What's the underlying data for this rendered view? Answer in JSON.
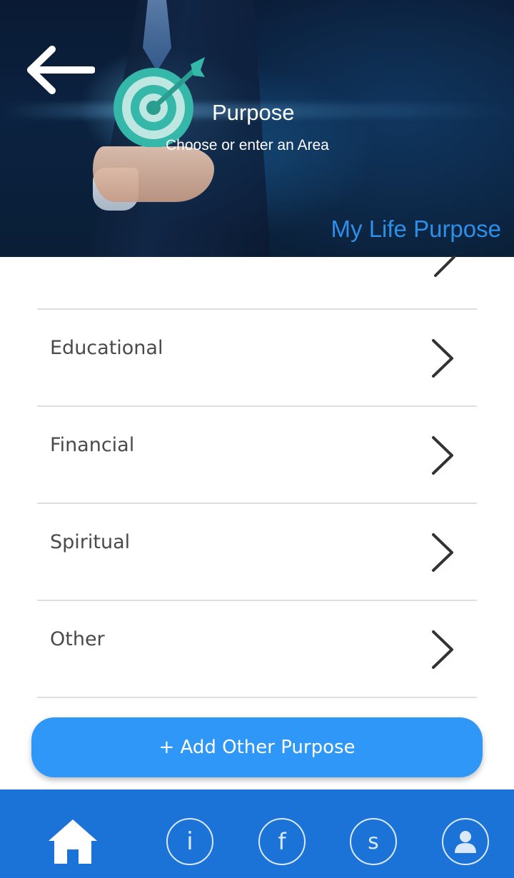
{
  "header": {
    "title": "Purpose",
    "subtitle": "Choose or enter an Area",
    "brand": "My Life Purpose",
    "brand_color": "#2d8fe8",
    "back_icon": "arrow-left-icon",
    "logo_icon": "target-arrow-icon"
  },
  "list": {
    "items": [
      {
        "label": "Educational"
      },
      {
        "label": "Financial"
      },
      {
        "label": "Spiritual"
      },
      {
        "label": "Other"
      }
    ]
  },
  "add_button": {
    "label": "+ Add Other Purpose",
    "color": "#2f97f7"
  },
  "bottom_nav": {
    "color": "#1b73d8",
    "items": [
      {
        "icon": "home-icon",
        "label": ""
      },
      {
        "icon": "info-icon",
        "label": "i"
      },
      {
        "icon": "facebook-icon",
        "label": "f"
      },
      {
        "icon": "s-icon",
        "label": "s"
      },
      {
        "icon": "profile-icon",
        "label": ""
      }
    ]
  }
}
